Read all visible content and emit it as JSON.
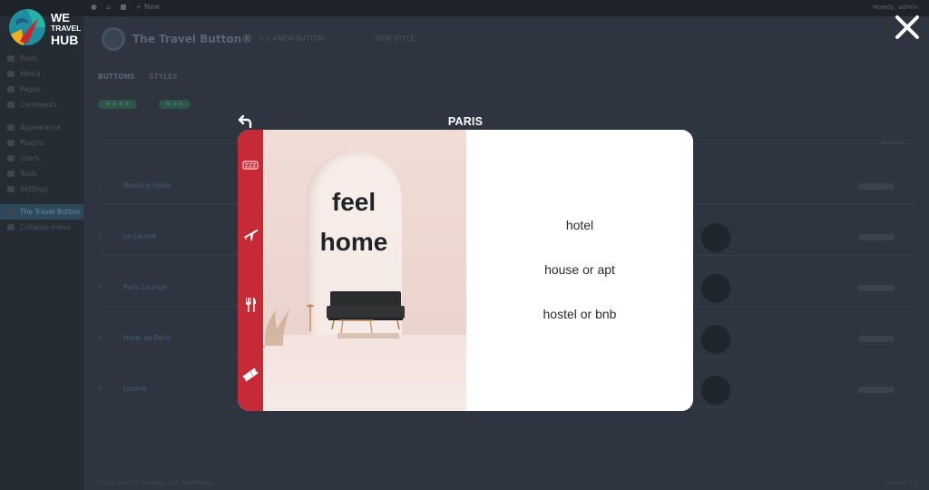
{
  "admin_bar": {
    "left_items": [
      "●",
      "⌂",
      "■",
      "+ New"
    ],
    "greeting": "Howdy, admin"
  },
  "admin_menu": {
    "items": [
      {
        "label": "Posts",
        "active": false
      },
      {
        "label": "Media",
        "active": false
      },
      {
        "label": "Pages",
        "active": false
      },
      {
        "label": "Comments",
        "active": false
      },
      {
        "label": "Appearance",
        "active": false
      },
      {
        "label": "Plugins",
        "active": false
      },
      {
        "label": "Users",
        "active": false
      },
      {
        "label": "Tools",
        "active": false
      },
      {
        "label": "Settings",
        "active": false
      },
      {
        "label": "The Travel Button",
        "active": true
      },
      {
        "label": "Collapse menu",
        "active": false
      }
    ]
  },
  "plugin": {
    "name": "The Travel Button®",
    "version": "v. 0.4",
    "link_1": "NEW BUTTON",
    "link_2": "NEW STYLE",
    "tabs": [
      "BUTTONS",
      "STYLES",
      "",
      ""
    ],
    "pills": [
      "● ● ● ●",
      "● ● ●"
    ],
    "column_right": "Actions",
    "rows": [
      {
        "num": "1",
        "name": "Booking Hotel"
      },
      {
        "num": "2",
        "name": "Le Louvre"
      },
      {
        "num": "3",
        "name": "Paris Lounge"
      },
      {
        "num": "4",
        "name": "Hotel de Paris"
      },
      {
        "num": "5",
        "name": "Louvre"
      }
    ],
    "footer": "Thank you for creating with WordPress.",
    "footer_version": "Version 5.6"
  },
  "brand": {
    "line1": "WE",
    "line2": "TRAVEL",
    "line3": "HUB"
  },
  "overlay": {
    "title": "PARIS",
    "slogan_line1": "feel",
    "slogan_line2": "home",
    "options": [
      "hotel",
      "house or apt",
      "hostel or bnb"
    ]
  },
  "colors": {
    "rail": "#c52a36",
    "overlay_bg": "#2e3540",
    "modal_bg": "#ffffff",
    "photo_tone": "#f1dcd6"
  },
  "icons": {
    "rail": [
      "sleep-zzz-icon",
      "airplane-icon",
      "fork-knife-icon",
      "ticket-icon"
    ],
    "close": "close-icon",
    "back": "back-arrow-icon"
  }
}
